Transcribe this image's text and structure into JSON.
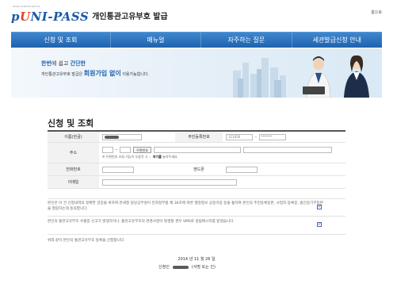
{
  "header": {
    "logo_prefix": "p",
    "logo_u": "U",
    "logo_rest": "NI-PASS",
    "logo_subtext": "Korea Customs Service",
    "title": "개인통관고유부호 발급",
    "home_link": "홈으로"
  },
  "nav": [
    "신청 및 조회",
    "매뉴얼",
    "자주하는 질문",
    "세관발급신청 안내"
  ],
  "banner": {
    "line1_pre": "한번",
    "line1_mid": "에 쉽고 ",
    "line1_bold": "간단한",
    "line2_pre": "개인통관고유부호 발급은 ",
    "line2_bold": "회원가입 없이",
    "line2_post": " 이용가능합니다."
  },
  "section_title": "신청 및 조회",
  "form": {
    "name_label": "이름(한글)",
    "rrn_label": "주민등록번호",
    "rrn_front": "121456",
    "rrn_back": "*******",
    "address_label": "주소",
    "zip_sep": "-",
    "zip_button": "우편번호",
    "address_note_pre": "※ 우편번호 조회 기능이 오동작 시",
    "address_note_bold": "여기를",
    "address_note_post": "눌러주세요.",
    "phone_label": "전화번호",
    "mobile_label": "핸드폰",
    "email_label": "이메일"
  },
  "consent": {
    "c1": "본인은 이 건 신청내역의 정확한 검증을 위하여 관세청 담당공무원이 전자정부법 제 36조에 따른 행정정보 공동이용 등을 통하여 본인의 주민등록등본, 사업자 등록증, 법인등기부등본을 열람하는데 동의합니다.",
    "c2": "본인의 통관고유부호 수출입 신고가 발생하거나, 통관고유부호의 변경사항이 발생할 경우 SMS로 알림메시지를 받겠습니다.",
    "c3": "위와 같이 본인의 통관고유부호 등록을 신청합니다."
  },
  "footer": {
    "date": "2014 년 11 월 26 일",
    "signer_label": "신청인",
    "sign_suffix": "(서명 또는 인)"
  },
  "colors": {
    "nav_blue": "#1f62ad",
    "accent_red": "#e0452a"
  }
}
